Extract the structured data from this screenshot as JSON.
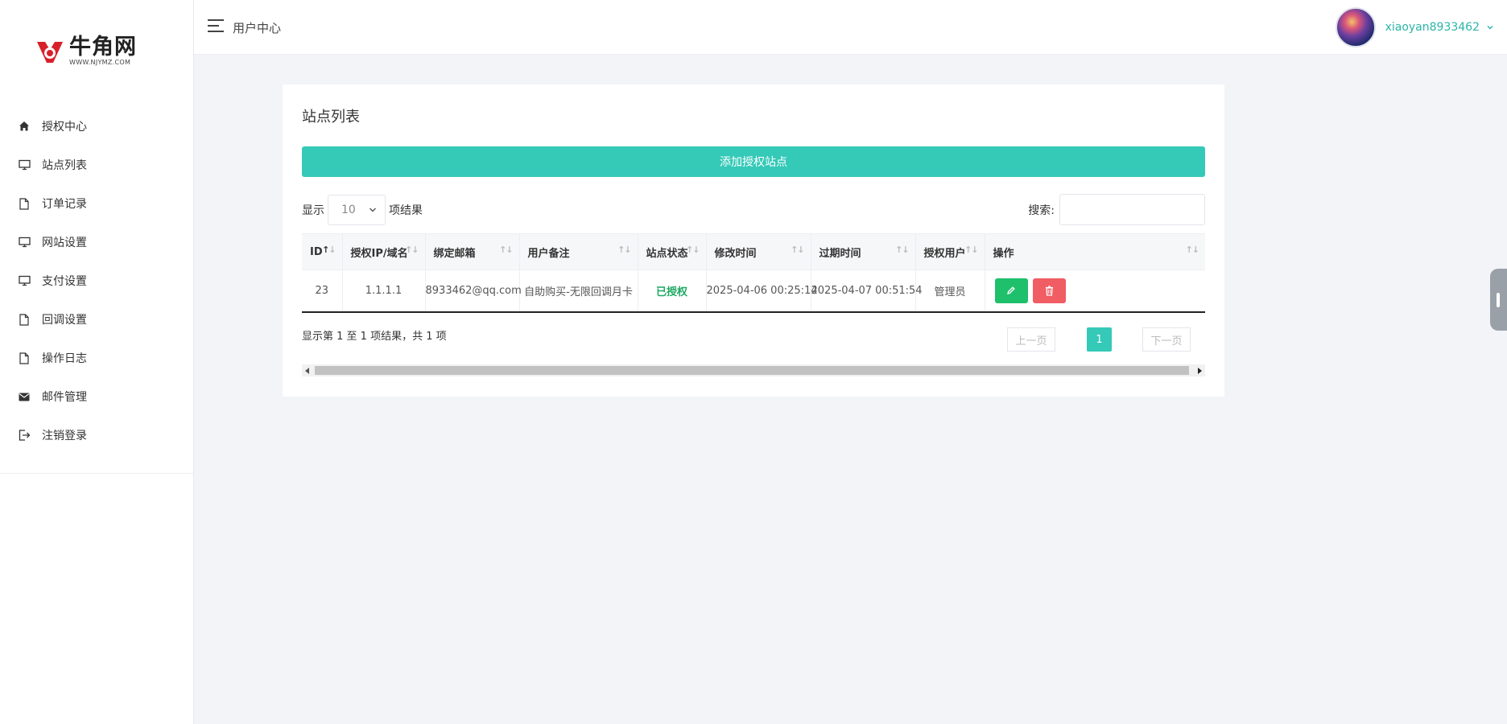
{
  "app": {
    "logo_name": "牛角网",
    "logo_url": "WWW.NJYMZ.COM",
    "header_title": "用户中心",
    "username": "xiaoyan8933462",
    "accent_color": "#35c9b8"
  },
  "sidebar": {
    "items": [
      {
        "label": "授权中心",
        "icon": "home-icon"
      },
      {
        "label": "站点列表",
        "icon": "monitor-icon"
      },
      {
        "label": "订单记录",
        "icon": "file-icon"
      },
      {
        "label": "网站设置",
        "icon": "monitor-icon"
      },
      {
        "label": "支付设置",
        "icon": "monitor-icon"
      },
      {
        "label": "回调设置",
        "icon": "file-icon"
      },
      {
        "label": "操作日志",
        "icon": "file-icon"
      },
      {
        "label": "邮件管理",
        "icon": "envelope-icon"
      },
      {
        "label": "注销登录",
        "icon": "logout-icon"
      }
    ]
  },
  "card": {
    "title": "站点列表",
    "add_button": "添加授权站点",
    "show_label": "显示",
    "page_length": "10",
    "results_label": "项结果",
    "search_label": "搜索:",
    "search_value": ""
  },
  "table": {
    "columns": [
      "ID",
      "授权IP/域名",
      "绑定邮箱",
      "用户备注",
      "站点状态",
      "修改时间",
      "过期时间",
      "授权用户",
      "操作"
    ],
    "rows": [
      {
        "id": "23",
        "domain": "1.1.1.1",
        "email": "8933462@qq.com",
        "remark": "自助购买-无限回调月卡",
        "status": "已授权",
        "modified": "2025-04-06 00:25:14",
        "expires": "2025-04-07 00:51:54",
        "user": "管理员"
      }
    ],
    "info": "显示第 1 至 1 项结果，共 1 项"
  },
  "pagination": {
    "prev": "上一页",
    "current": "1",
    "next": "下一页"
  }
}
